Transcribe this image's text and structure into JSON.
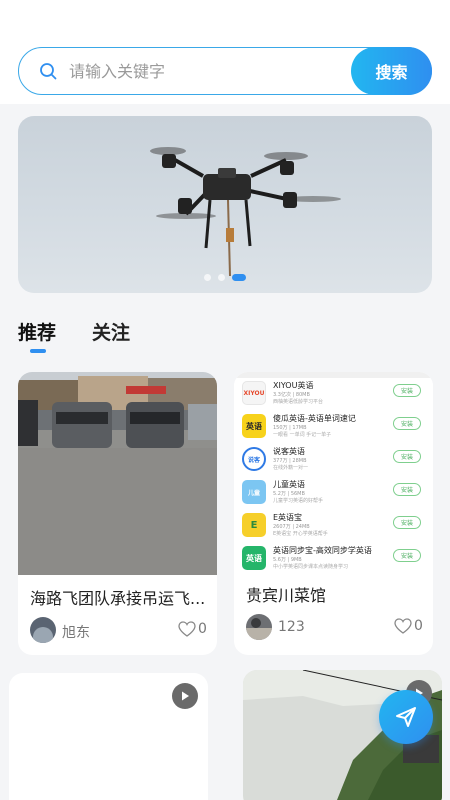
{
  "search": {
    "placeholder": "请输入关键字",
    "button_label": "搜索"
  },
  "banner": {
    "slide_count": 3,
    "active_slide": 3
  },
  "tabs": [
    {
      "label": "推荐",
      "active": true
    },
    {
      "label": "关注",
      "active": false
    }
  ],
  "feed": [
    {
      "title": "海路飞团队承接吊运飞...",
      "author": "旭东",
      "likes": "0",
      "type": "image"
    },
    {
      "title": "贵宾川菜馆",
      "author": "123",
      "likes": "0",
      "type": "image",
      "app_list": [
        {
          "name": "XIYOU英语",
          "meta": "3.3亿次 | 80MB",
          "desc": "西柚英语低龄学习平台",
          "icon_text": "XIYOU",
          "icon_color": "#f5f5f5",
          "install": "安装"
        },
        {
          "name": "傻瓜英语-英语单词速记",
          "meta": "150万 | 17MB",
          "desc": "一眼看 一单词 手记一单子",
          "icon_text": "英语",
          "icon_color": "#f7d21b",
          "install": "安装"
        },
        {
          "name": "说客英语",
          "meta": "377万 | 28MB",
          "desc": "在线外籍一对一",
          "icon_text": "说客",
          "icon_color": "#2f7ae5",
          "install": "安装"
        },
        {
          "name": "儿童英语",
          "meta": "5.2万 | 56MB",
          "desc": "儿童学习英语的好帮手",
          "icon_text": "儿童",
          "icon_color": "#7cc6f2",
          "install": "安装"
        },
        {
          "name": "E英语宝",
          "meta": "2607万 | 24MB",
          "desc": "E英语宝 开心学英语帮手",
          "icon_text": "E",
          "icon_color": "#f6cf2a",
          "install": "安装"
        },
        {
          "name": "英语同步宝-高效同步学英语",
          "meta": "5.6万 | 9MB",
          "desc": "中小学英语同步课本点读随身学习",
          "icon_text": "英语",
          "icon_color": "#25b56a",
          "install": "安装"
        }
      ]
    },
    {
      "title": "",
      "author": "",
      "likes": "",
      "type": "video"
    },
    {
      "title": "",
      "author": "",
      "likes": "",
      "type": "video"
    }
  ],
  "colors": {
    "accent": "#2f8ff0",
    "accent_light": "#22b6f0",
    "background": "#f4f5f7"
  },
  "icons": {
    "search": "search-icon",
    "like": "heart-icon",
    "play": "play-icon",
    "fab": "send-icon"
  }
}
